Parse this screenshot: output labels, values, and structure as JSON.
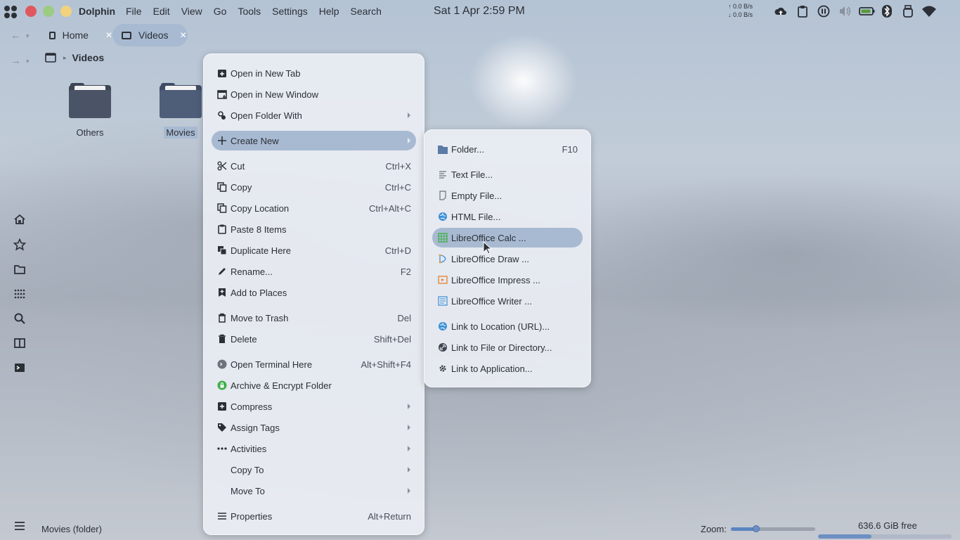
{
  "topbar": {
    "app_name": "Dolphin",
    "menus": [
      "File",
      "Edit",
      "View",
      "Go",
      "Tools",
      "Settings",
      "Help",
      "Search"
    ],
    "clock": "Sat 1 Apr  2:59 PM",
    "net_up": "↑     0.0 B/s",
    "net_down": "↓     0.0 B/s",
    "window_controls": {
      "close_color": "#e0585e",
      "minimize_color": "#9ccb82",
      "maximize_color": "#f2d27c"
    },
    "tray_icons": [
      "cloud-upload-icon",
      "clipboard-icon",
      "pause-icon",
      "volume-icon",
      "battery-icon",
      "bluetooth-icon",
      "usb-icon",
      "wifi-icon"
    ]
  },
  "tabs": [
    {
      "label": "Home",
      "icon": "folder-icon",
      "active": false
    },
    {
      "label": "Videos",
      "icon": "folder-icon",
      "active": true
    }
  ],
  "breadcrumb": {
    "current": "Videos",
    "icon": "film-icon"
  },
  "files": [
    {
      "name": "Others",
      "selected": false
    },
    {
      "name": "Movies",
      "selected": true
    }
  ],
  "places_icons": [
    "home-icon",
    "star-icon",
    "folder-icon",
    "apps-icon",
    "search-icon",
    "split-view-icon",
    "terminal-icon"
  ],
  "status": {
    "text": "Movies (folder)",
    "zoom_label": "Zoom:",
    "zoom_level": 0.3,
    "free_space": "636.6 GiB free",
    "used_fraction": 0.4
  },
  "context_menu": {
    "items": [
      {
        "label": "Open in New Tab",
        "shortcut": "",
        "icon": "new-tab-icon",
        "submenu": false
      },
      {
        "label": "Open in New Window",
        "shortcut": "",
        "icon": "new-window-icon",
        "submenu": false
      },
      {
        "label": "Open Folder With",
        "shortcut": "",
        "icon": "open-with-icon",
        "submenu": true
      },
      {
        "label": "Create New",
        "shortcut": "",
        "icon": "plus-icon",
        "submenu": true,
        "highlighted": true
      },
      {
        "label": "Cut",
        "shortcut": "Ctrl+X",
        "icon": "scissors-icon",
        "submenu": false
      },
      {
        "label": "Copy",
        "shortcut": "Ctrl+C",
        "icon": "copy-icon",
        "submenu": false
      },
      {
        "label": "Copy Location",
        "shortcut": "Ctrl+Alt+C",
        "icon": "copy-location-icon",
        "submenu": false
      },
      {
        "label": "Paste 8 Items",
        "shortcut": "",
        "icon": "paste-icon",
        "submenu": false
      },
      {
        "label": "Duplicate Here",
        "shortcut": "Ctrl+D",
        "icon": "duplicate-icon",
        "submenu": false
      },
      {
        "label": "Rename...",
        "shortcut": "F2",
        "icon": "pencil-icon",
        "submenu": false
      },
      {
        "label": "Add to Places",
        "shortcut": "",
        "icon": "bookmark-add-icon",
        "submenu": false
      },
      {
        "label": "Move to Trash",
        "shortcut": "Del",
        "icon": "trash-icon",
        "submenu": false
      },
      {
        "label": "Delete",
        "shortcut": "Shift+Del",
        "icon": "delete-icon",
        "submenu": false
      },
      {
        "label": "Open Terminal Here",
        "shortcut": "Alt+Shift+F4",
        "icon": "terminal-icon",
        "submenu": false
      },
      {
        "label": "Archive & Encrypt Folder",
        "shortcut": "",
        "icon": "lock-icon",
        "submenu": false
      },
      {
        "label": "Compress",
        "shortcut": "",
        "icon": "archive-icon",
        "submenu": true
      },
      {
        "label": "Assign Tags",
        "shortcut": "",
        "icon": "tag-icon",
        "submenu": true
      },
      {
        "label": "Activities",
        "shortcut": "",
        "icon": "dots-icon",
        "submenu": true
      },
      {
        "label": "Copy To",
        "shortcut": "",
        "icon": "",
        "submenu": true
      },
      {
        "label": "Move To",
        "shortcut": "",
        "icon": "",
        "submenu": true
      },
      {
        "label": "Properties",
        "shortcut": "Alt+Return",
        "icon": "list-icon",
        "submenu": false
      }
    ]
  },
  "create_new_menu": {
    "items": [
      {
        "label": "Folder...",
        "shortcut": "F10",
        "icon": "folder-icon"
      },
      {
        "label": "Text File...",
        "shortcut": "",
        "icon": "text-file-icon"
      },
      {
        "label": "Empty File...",
        "shortcut": "",
        "icon": "empty-file-icon"
      },
      {
        "label": "HTML File...",
        "shortcut": "",
        "icon": "globe-icon"
      },
      {
        "label": "LibreOffice Calc  ...",
        "shortcut": "",
        "icon": "calc-icon",
        "highlighted": true
      },
      {
        "label": "LibreOffice Draw  ...",
        "shortcut": "",
        "icon": "draw-icon"
      },
      {
        "label": "LibreOffice Impress  ...",
        "shortcut": "",
        "icon": "impress-icon"
      },
      {
        "label": "LibreOffice Writer  ...",
        "shortcut": "",
        "icon": "writer-icon"
      },
      {
        "label": "Link to Location (URL)...",
        "shortcut": "",
        "icon": "globe-link-icon"
      },
      {
        "label": "Link to File or Directory...",
        "shortcut": "",
        "icon": "link-icon"
      },
      {
        "label": "Link to Application...",
        "shortcut": "",
        "icon": "gear-icon"
      }
    ]
  },
  "colors": {
    "accent": "#a8bad2",
    "calc": "#3fae49",
    "draw": "#e8a33a",
    "impress": "#e8812a",
    "writer": "#3a8fd6",
    "link": "#3a8fd6"
  }
}
